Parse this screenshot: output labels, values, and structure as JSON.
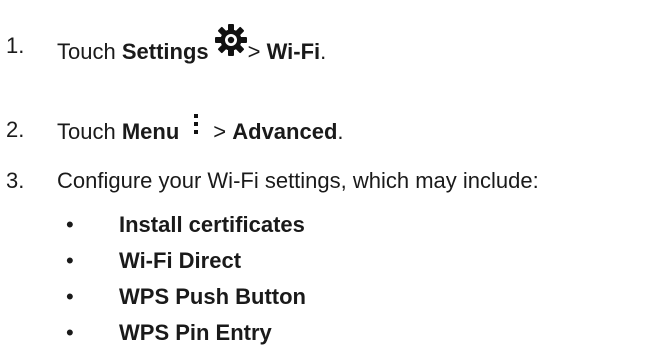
{
  "steps": [
    {
      "number": "1.",
      "prefix": "Touch ",
      "bold1": "Settings",
      "icon": "gear-icon",
      "sep": "> ",
      "bold2": "Wi-Fi",
      "suffix": "."
    },
    {
      "number": "2.",
      "prefix": "Touch ",
      "bold1": "Menu",
      "icon": "overflow-menu-icon",
      "sep": "> ",
      "bold2": "Advanced",
      "suffix": "."
    },
    {
      "number": "3.",
      "text": "Configure your Wi-Fi settings, which may include:"
    }
  ],
  "bullet_char": "•",
  "options": [
    "Install certificates",
    "Wi-Fi Direct",
    "WPS Push Button",
    "WPS Pin Entry"
  ]
}
